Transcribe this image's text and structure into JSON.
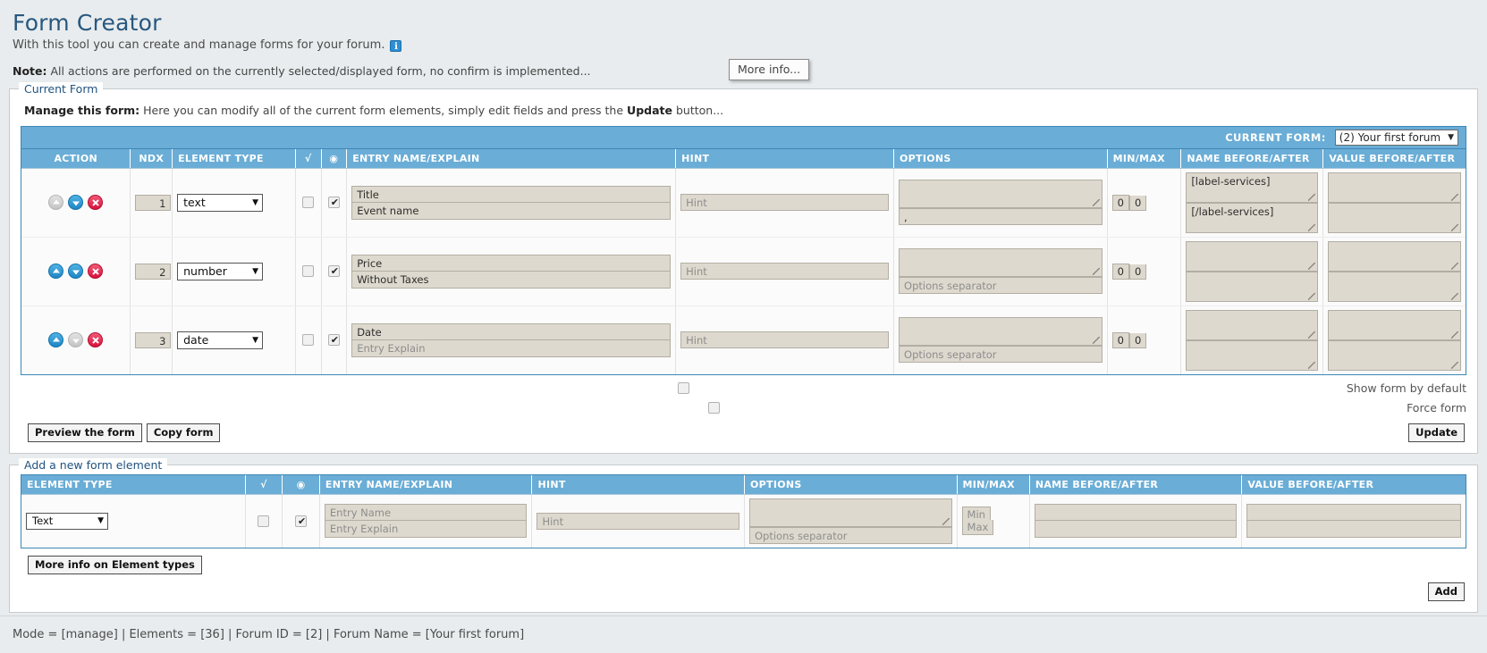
{
  "header": {
    "title": "Form Creator",
    "subtitle": "With this tool you can create and manage forms for your forum.",
    "info_icon": "info-icon",
    "tooltip": "More info...",
    "note_label": "Note:",
    "note_text": "All actions are performed on the currently selected/displayed form, no confirm is implemented..."
  },
  "current_form": {
    "legend": "Current Form",
    "manage_label": "Manage this form:",
    "manage_text_1": "Here you can modify all of the current form elements, simply edit fields and press the",
    "manage_strong": "Update",
    "manage_text_2": "button...",
    "bar_label": "CURRENT FORM:",
    "selected_form": "(2) Your first forum",
    "caret": "▼",
    "columns": {
      "action": "ACTION",
      "ndx": "NDX",
      "element_type": "ELEMENT TYPE",
      "required": "√",
      "visible": "◉",
      "entry": "ENTRY NAME/EXPLAIN",
      "hint": "HINT",
      "options": "OPTIONS",
      "minmax": "MIN/MAX",
      "name_ba": "NAME BEFORE/AFTER",
      "value_ba": "VALUE BEFORE/AFTER"
    },
    "rows": [
      {
        "up_state": "disabled",
        "down_state": "enabled",
        "delete_icon": "delete-icon",
        "ndx": "1",
        "element_type": "text",
        "required_checked": false,
        "visible_checked": true,
        "entry_name": "Title",
        "entry_explain": "Event name",
        "entry_explain_is_placeholder": false,
        "hint": "Hint",
        "hint_is_placeholder": true,
        "options": "",
        "options_sep": ",",
        "options_sep_is_placeholder": false,
        "min": "0",
        "max": "0",
        "name_before": "[label-services]",
        "name_after": "[/label-services]",
        "value_before": "",
        "value_after": ""
      },
      {
        "up_state": "enabled",
        "down_state": "enabled",
        "delete_icon": "delete-icon",
        "ndx": "2",
        "element_type": "number",
        "required_checked": false,
        "visible_checked": true,
        "entry_name": "Price",
        "entry_explain": "Without Taxes",
        "entry_explain_is_placeholder": false,
        "hint": "Hint",
        "hint_is_placeholder": true,
        "options": "",
        "options_sep": "Options separator",
        "options_sep_is_placeholder": true,
        "min": "0",
        "max": "0",
        "name_before": "",
        "name_after": "",
        "value_before": "",
        "value_after": ""
      },
      {
        "up_state": "enabled",
        "down_state": "disabled",
        "delete_icon": "delete-icon",
        "ndx": "3",
        "element_type": "date",
        "required_checked": false,
        "visible_checked": true,
        "entry_name": "Date",
        "entry_explain": "Entry Explain",
        "entry_explain_is_placeholder": true,
        "hint": "Hint",
        "hint_is_placeholder": true,
        "options": "",
        "options_sep": "Options separator",
        "options_sep_is_placeholder": true,
        "min": "0",
        "max": "0",
        "name_before": "",
        "name_after": "",
        "value_before": "",
        "value_after": ""
      }
    ],
    "show_form_label": "Show form by default",
    "show_form_checked": false,
    "force_form_label": "Force form",
    "force_form_checked": false,
    "preview_button": "Preview the form",
    "copy_button": "Copy form",
    "update_button": "Update"
  },
  "add_element": {
    "legend": "Add a new form element",
    "columns": {
      "element_type": "ELEMENT TYPE",
      "required": "√",
      "visible": "◉",
      "entry": "ENTRY NAME/EXPLAIN",
      "hint": "HINT",
      "options": "OPTIONS",
      "minmax": "MIN/MAX",
      "name_ba": "NAME BEFORE/AFTER",
      "value_ba": "VALUE BEFORE/AFTER"
    },
    "row": {
      "element_type": "Text",
      "required_checked": false,
      "visible_checked": true,
      "entry_name": "Entry Name",
      "entry_explain": "Entry Explain",
      "hint": "Hint",
      "options": "",
      "options_sep": "Options separator",
      "min": "Min",
      "max": "Max",
      "name_before": "",
      "name_after": "",
      "value_before": "",
      "value_after": ""
    },
    "more_info_button": "More info on Element types",
    "add_button": "Add"
  },
  "footer": {
    "status": "Mode = [manage] | Elements = [36] | Forum ID = [2] | Forum Name = [Your first forum]"
  }
}
